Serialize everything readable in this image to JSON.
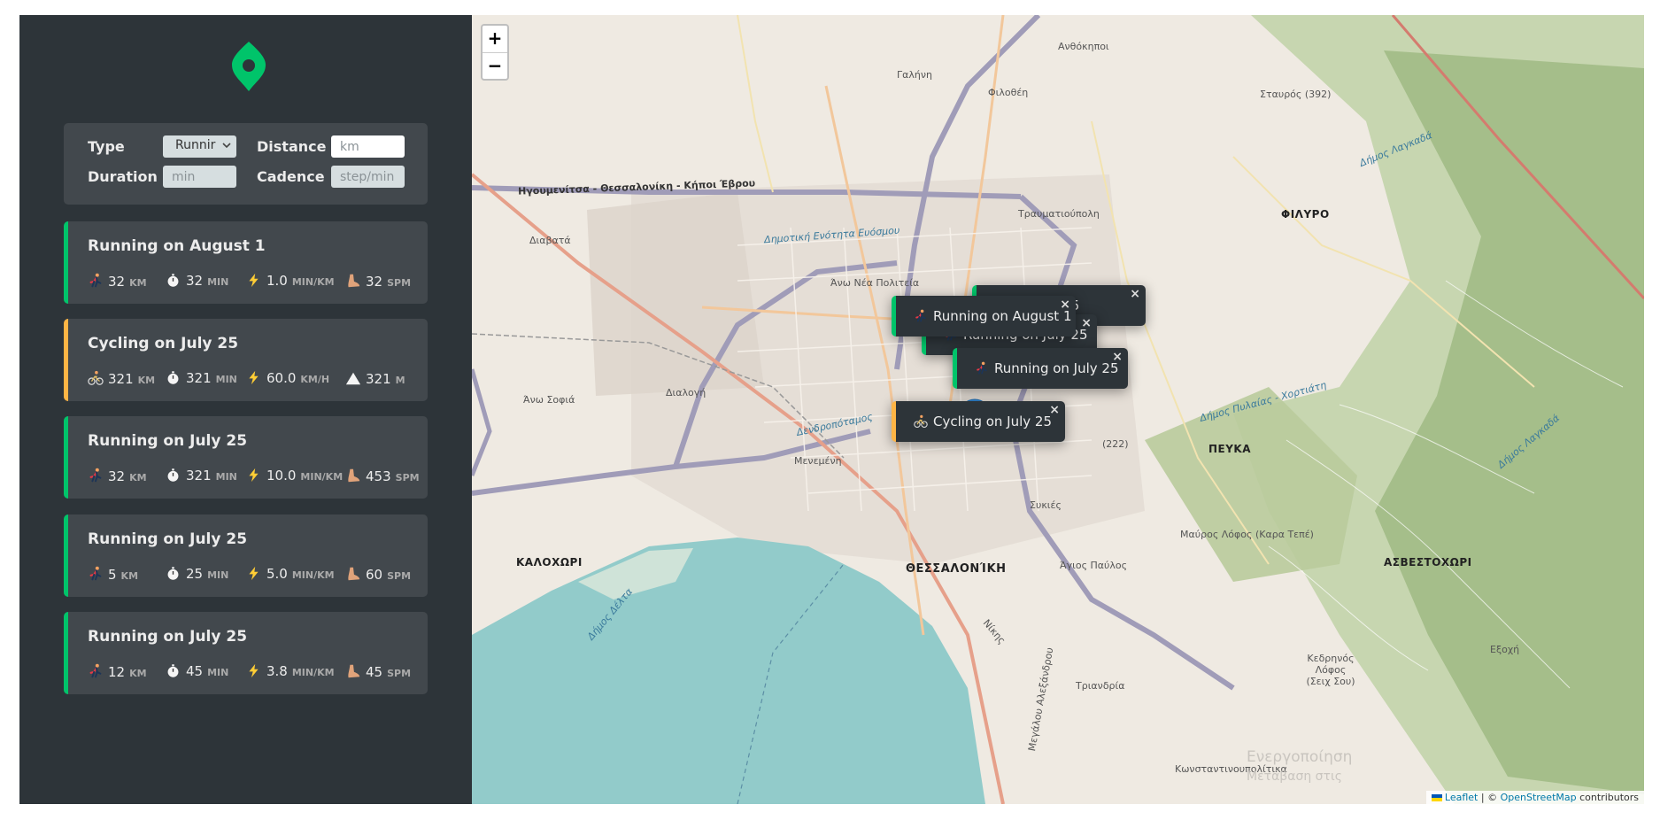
{
  "logo": {
    "icon": "map-pin-logo-icon",
    "color": "#00c46a"
  },
  "form": {
    "type_label": "Type",
    "type_value": "Runnir",
    "distance_label": "Distance",
    "distance_placeholder": "km",
    "duration_label": "Duration",
    "duration_placeholder": "min",
    "cadence_label": "Cadence",
    "cadence_placeholder": "step/min"
  },
  "workouts": [
    {
      "type": "running",
      "title": "Running on August 1",
      "stats": [
        {
          "icon": "runner-icon",
          "value": "32",
          "unit": "KM"
        },
        {
          "icon": "stopwatch-icon",
          "value": "32",
          "unit": "MIN"
        },
        {
          "icon": "lightning-icon",
          "value": "1.0",
          "unit": "MIN/KM"
        },
        {
          "icon": "footprint-icon",
          "value": "32",
          "unit": "SPM"
        }
      ]
    },
    {
      "type": "cycling",
      "title": "Cycling on July 25",
      "stats": [
        {
          "icon": "cyclist-icon",
          "value": "321",
          "unit": "KM"
        },
        {
          "icon": "stopwatch-icon",
          "value": "321",
          "unit": "MIN"
        },
        {
          "icon": "lightning-icon",
          "value": "60.0",
          "unit": "KM/H"
        },
        {
          "icon": "mountain-icon",
          "value": "321",
          "unit": "M"
        }
      ]
    },
    {
      "type": "running",
      "title": "Running on July 25",
      "stats": [
        {
          "icon": "runner-icon",
          "value": "32",
          "unit": "KM"
        },
        {
          "icon": "stopwatch-icon",
          "value": "321",
          "unit": "MIN"
        },
        {
          "icon": "lightning-icon",
          "value": "10.0",
          "unit": "MIN/KM"
        },
        {
          "icon": "footprint-icon",
          "value": "453",
          "unit": "SPM"
        }
      ]
    },
    {
      "type": "running",
      "title": "Running on July 25",
      "stats": [
        {
          "icon": "runner-icon",
          "value": "5",
          "unit": "KM"
        },
        {
          "icon": "stopwatch-icon",
          "value": "25",
          "unit": "MIN"
        },
        {
          "icon": "lightning-icon",
          "value": "5.0",
          "unit": "MIN/KM"
        },
        {
          "icon": "footprint-icon",
          "value": "60",
          "unit": "SPM"
        }
      ]
    },
    {
      "type": "running",
      "title": "Running on July 25",
      "stats": [
        {
          "icon": "runner-icon",
          "value": "12",
          "unit": "KM"
        },
        {
          "icon": "stopwatch-icon",
          "value": "45",
          "unit": "MIN"
        },
        {
          "icon": "lightning-icon",
          "value": "3.8",
          "unit": "MIN/KM"
        },
        {
          "icon": "footprint-icon",
          "value": "45",
          "unit": "SPM"
        }
      ]
    }
  ],
  "map": {
    "zoom_in": "+",
    "zoom_out": "−",
    "popups": [
      {
        "type": "running",
        "icon": "runner-icon",
        "text": "on July 25"
      },
      {
        "type": "running",
        "icon": "runner-icon",
        "text": "Running on July 25"
      },
      {
        "type": "running",
        "icon": "runner-icon",
        "text": "Running on August 1"
      },
      {
        "type": "running",
        "icon": "runner-icon",
        "text": "Running on July 25"
      },
      {
        "type": "cycling",
        "icon": "cyclist-icon",
        "text": "Cycling on July 25"
      }
    ],
    "close_glyph": "×",
    "places": {
      "thessaloniki": "ΘΕΣΣΑΛΟΝΊΚΗ",
      "kalochori": "ΚΑΛΟΧΩΡΙ",
      "pefka": "ΠΕΥΚΑ",
      "filyro": "ΦΙΛΥΡΟ",
      "asvestochori": "ΑΣΒΕΣΤΟΧΩΡΙ",
      "egnatia": "Ηγουμενίτσα - Θεσσαλονίκη - Κήποι Έβρου",
      "stavros": "Σταυρός (392)",
      "galini": "Γαλήνη",
      "filothei": "Φιλοθέη",
      "anthokipi": "Ανθόκηποι",
      "diavata": "Διαβατά",
      "evosmos": "Δημοτική Ενότητα Ευόσμου",
      "ano_nea_politeia": "Άνω Νέα Πολιτεία",
      "triandria": "Τριανδρία",
      "sykies": "Συκιές",
      "agios_pavlos": "Άγιος Παύλος",
      "menemeni": "Μενεμένη",
      "dendropotamos": "Δενδροπόταμος",
      "ano_sofia": "Άνω Σοφιά",
      "diaxogi": "Διαλογή",
      "trafmatiopoli": "Τραυματιούπολη",
      "mavros_lofos": "Μαύρος Λόφος (Καρα Τεπέ)",
      "kedrinos_lofos": "Κεδρηνός Λόφος (Σειχ Σου)",
      "exochi": "Εξοχή",
      "kounstantinoupolitika": "Κωνσταντινουπολίτικα",
      "megalou_alexandrou": "Μεγάλου Αλεξάνδρου",
      "nikis": "Νίκης",
      "dimos_pylaias": "Δήμος Πυλαίας - Χορτιάτη",
      "dimos_lagada": "Δήμος Λαγκαδά",
      "dimos_delta": "Δήμος Δέλτα",
      "road_222": "(222)",
      "watermark1": "Ενεργοποίηση",
      "watermark2": "Μετάβαση στις"
    },
    "attribution": {
      "leaflet": "Leaflet",
      "sep": " | © ",
      "osm": "OpenStreetMap",
      "contributors": " contributors"
    },
    "colors": {
      "water": "#92cbca",
      "forest": "#a5be8a",
      "land": "#efeae2",
      "marker": "#3388d6"
    }
  }
}
